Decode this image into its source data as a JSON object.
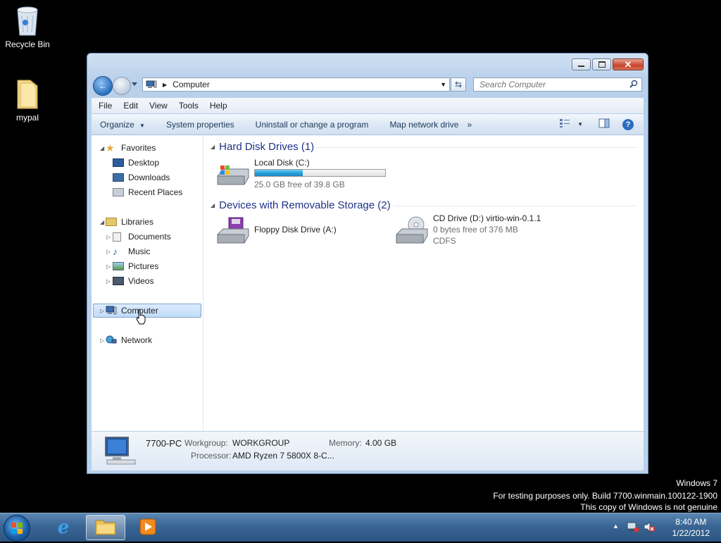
{
  "desktop": {
    "icons": [
      {
        "label": "Recycle Bin"
      },
      {
        "label": "mypal"
      }
    ]
  },
  "window": {
    "address": {
      "location": "Computer"
    },
    "search": {
      "placeholder": "Search Computer"
    },
    "menu": [
      "File",
      "Edit",
      "View",
      "Tools",
      "Help"
    ],
    "toolbar": {
      "organize": "Organize",
      "system_properties": "System properties",
      "uninstall": "Uninstall or change a program",
      "map_drive": "Map network drive",
      "more": "»"
    },
    "nav": {
      "favorites": "Favorites",
      "desktop": "Desktop",
      "downloads": "Downloads",
      "recent_places": "Recent Places",
      "libraries": "Libraries",
      "documents": "Documents",
      "music": "Music",
      "pictures": "Pictures",
      "videos": "Videos",
      "computer": "Computer",
      "network": "Network"
    },
    "groups": {
      "hdd_title": "Hard Disk Drives (1)",
      "removable_title": "Devices with Removable Storage (2)"
    },
    "drives": {
      "local": {
        "name": "Local Disk (C:)",
        "free": "25.0 GB free of 39.8 GB",
        "used_fraction": 0.37
      },
      "floppy": {
        "name": "Floppy Disk Drive (A:)"
      },
      "cd": {
        "name": "CD Drive (D:) virtio-win-0.1.1",
        "free": "0 bytes free of 376 MB",
        "fs": "CDFS"
      }
    },
    "details": {
      "pc_name": "7700-PC",
      "workgroup_label": "Workgroup:",
      "workgroup": "WORKGROUP",
      "memory_label": "Memory:",
      "memory": "4.00 GB",
      "processor_label": "Processor:",
      "processor": "AMD Ryzen 7 5800X 8-C..."
    }
  },
  "watermark": {
    "line1": "Windows 7",
    "line2": "For testing purposes only. Build 7700.winmain.100122-1900",
    "line3": "This copy of Windows is not genuine"
  },
  "taskbar": {
    "time": "8:40 AM",
    "date": "1/22/2012"
  }
}
